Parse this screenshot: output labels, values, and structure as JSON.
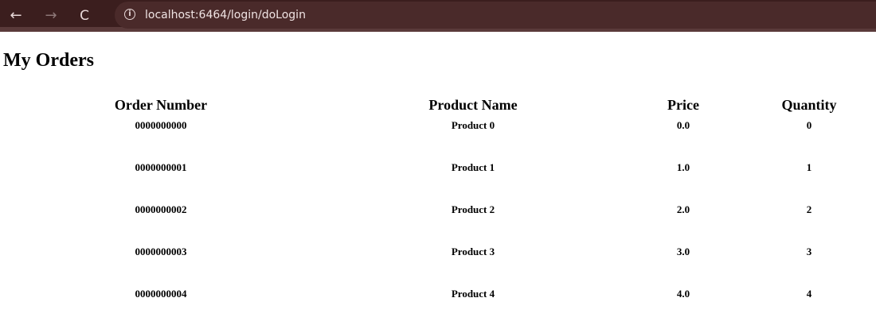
{
  "browser": {
    "back_icon": "←",
    "forward_icon": "→",
    "reload_icon": "C",
    "info_icon": "i",
    "url": "localhost:6464/login/doLogin",
    "toolbar_color": "#3b1e1e"
  },
  "page": {
    "title": "My Orders"
  },
  "table": {
    "headers": {
      "order_number": "Order Number",
      "product_name": "Product Name",
      "price": "Price",
      "quantity": "Quantity"
    },
    "rows": [
      {
        "order_number": "0000000000",
        "product_name": "Product 0",
        "price": "0.0",
        "quantity": "0"
      },
      {
        "order_number": "0000000001",
        "product_name": "Product 1",
        "price": "1.0",
        "quantity": "1"
      },
      {
        "order_number": "0000000002",
        "product_name": "Product 2",
        "price": "2.0",
        "quantity": "2"
      },
      {
        "order_number": "0000000003",
        "product_name": "Product 3",
        "price": "3.0",
        "quantity": "3"
      },
      {
        "order_number": "0000000004",
        "product_name": "Product 4",
        "price": "4.0",
        "quantity": "4"
      }
    ]
  }
}
